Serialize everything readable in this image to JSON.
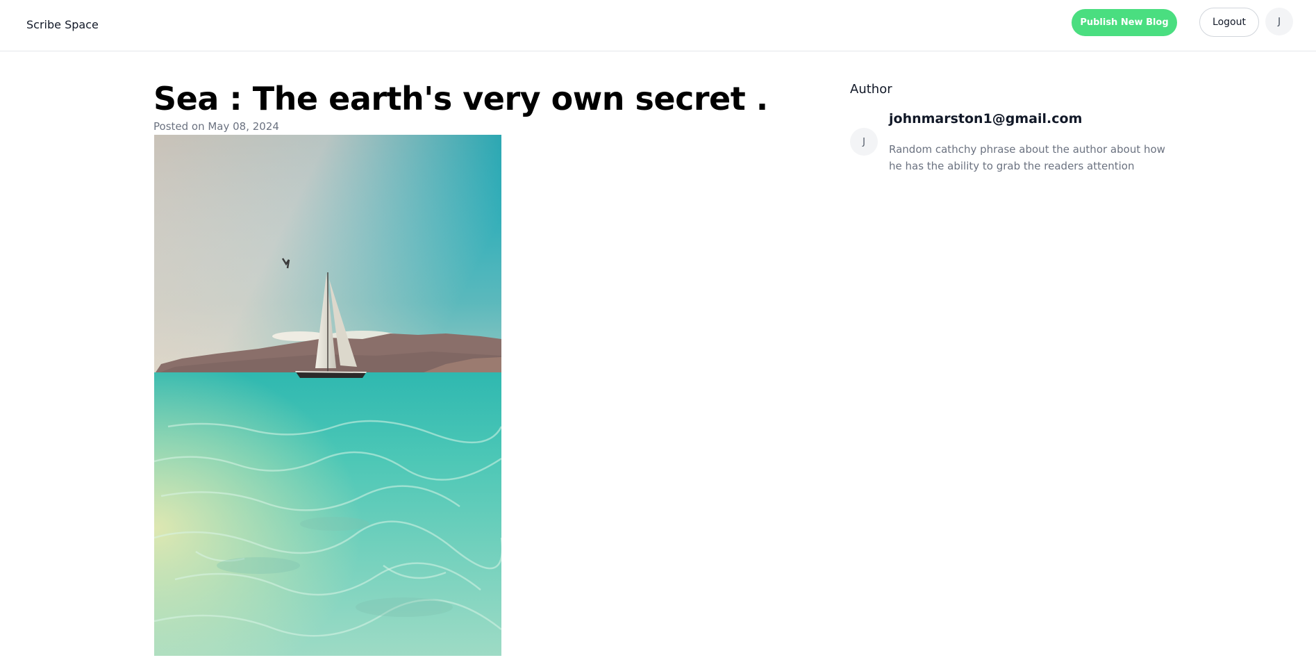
{
  "header": {
    "brand": "Scribe Space",
    "publish_label": "Publish New Blog",
    "logout_label": "Logout",
    "avatar_initial": "J"
  },
  "post": {
    "title": "Sea : The earth's very own secret .",
    "posted_on": "Posted on May 08, 2024"
  },
  "author": {
    "heading": "Author",
    "avatar_initial": "J",
    "email": "johnmarston1@gmail.com",
    "bio": "Random cathchy phrase about the author about how he has the ability to grab the readers attention"
  },
  "colors": {
    "accent": "#4ade80",
    "muted_text": "#6b7280",
    "border": "#e5e7eb"
  }
}
